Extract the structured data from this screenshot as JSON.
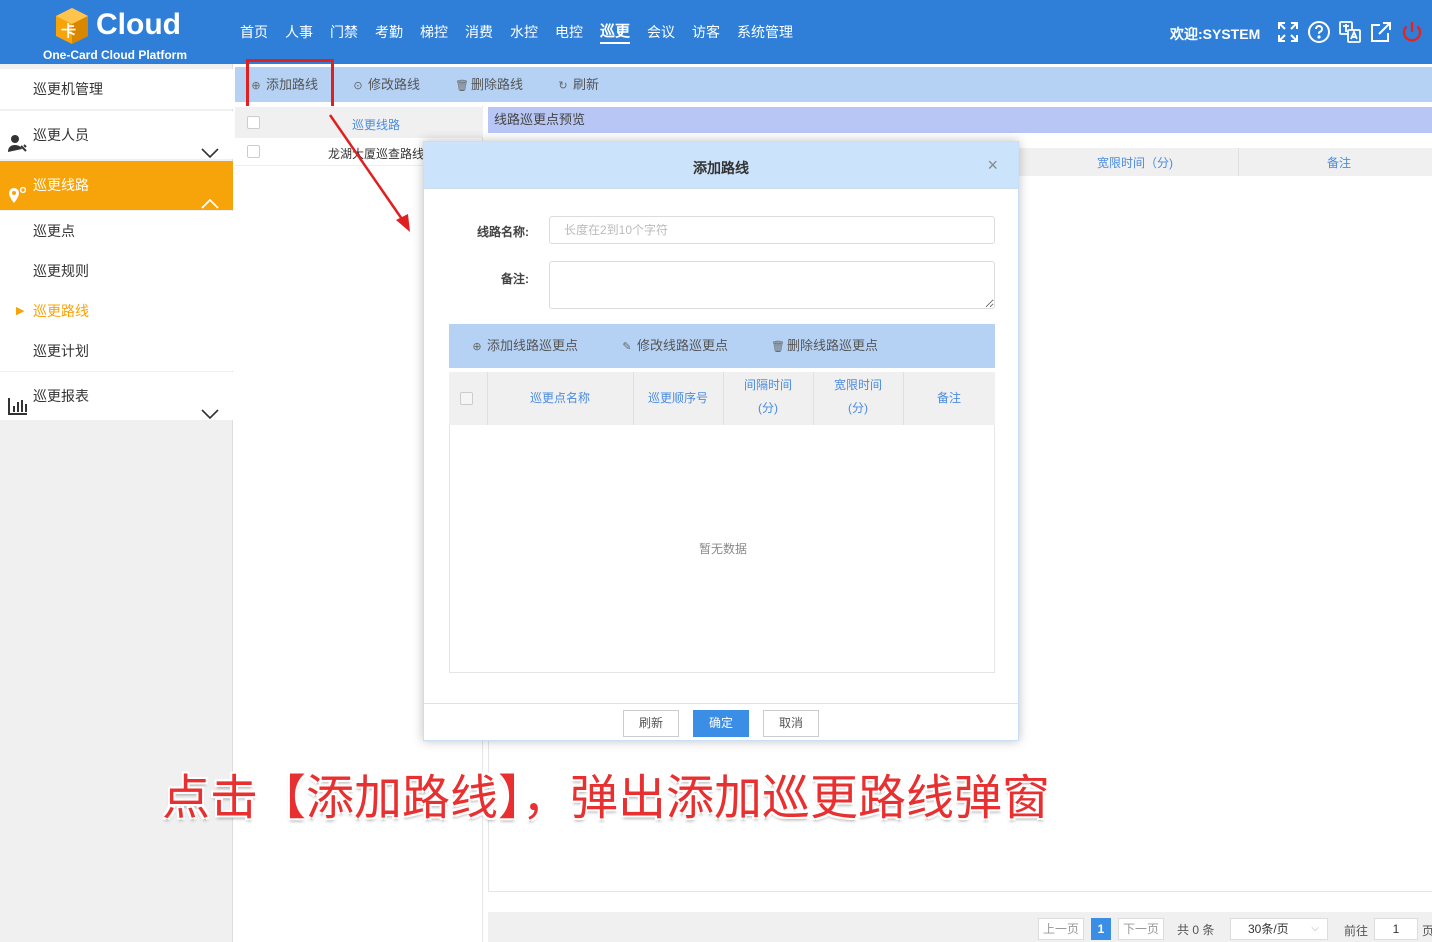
{
  "header": {
    "logo_text": "Cloud",
    "logo_badge": "卡",
    "logo_subtitle": "One-Card Cloud Platform",
    "nav": [
      "首页",
      "人事",
      "门禁",
      "考勤",
      "梯控",
      "消费",
      "水控",
      "电控",
      "巡更",
      "会议",
      "访客",
      "系统管理"
    ],
    "active_nav": "巡更",
    "welcome": "欢迎:SYSTEM",
    "icons": [
      "fullscreen-icon",
      "help-icon",
      "language-icon",
      "external-link-icon",
      "power-icon"
    ],
    "brand_color": "#2f7fd8"
  },
  "sidebar": {
    "items": [
      {
        "label": "巡更机管理",
        "type": "sub"
      },
      {
        "label": "巡更人员",
        "type": "group",
        "icon": "person-icon",
        "expanded": false
      },
      {
        "label": "巡更线路",
        "type": "group",
        "icon": "location-pin-icon",
        "expanded": true,
        "active": true
      },
      {
        "label": "巡更点",
        "type": "sub"
      },
      {
        "label": "巡更规则",
        "type": "sub"
      },
      {
        "label": "巡更路线",
        "type": "sub",
        "current": true
      },
      {
        "label": "巡更计划",
        "type": "sub"
      },
      {
        "label": "巡更报表",
        "type": "group",
        "icon": "bar-chart-icon",
        "expanded": false
      }
    ],
    "accent_color": "#f7a30a"
  },
  "toolbar": {
    "add": "添加路线",
    "edit": "修改路线",
    "delete": "删除路线",
    "refresh": "刷新"
  },
  "left_table": {
    "header": "巡更线路",
    "rows": [
      "龙湖大厦巡查路线"
    ]
  },
  "right_panel": {
    "title": "线路巡更点预览",
    "columns": [
      "宽限时间（分)",
      "备注"
    ]
  },
  "pagination": {
    "prev": "上一页",
    "current_page": "1",
    "next": "下一页",
    "total": "共 0 条",
    "page_size": "30条/页",
    "goto_label": "前往",
    "goto_value": "1",
    "page_suffix": "页"
  },
  "modal": {
    "title": "添加路线",
    "name_label": "线路名称:",
    "name_placeholder": "长度在2到10个字符",
    "name_value": "",
    "remark_label": "备注:",
    "toolbar": {
      "add": "添加线路巡更点",
      "edit": "修改线路巡更点",
      "delete": "删除线路巡更点"
    },
    "columns": {
      "name": "巡更点名称",
      "order": "巡更顺序号",
      "interval_1": "间隔时间",
      "interval_2": "(分)",
      "grace_1": "宽限时间",
      "grace_2": "(分)",
      "remark": "备注"
    },
    "empty_text": "暂无数据",
    "buttons": {
      "refresh": "刷新",
      "confirm": "确定",
      "cancel": "取消"
    }
  },
  "caption": "点击【添加路线】，弹出添加巡更路线弹窗",
  "caption_color": "#e83030"
}
